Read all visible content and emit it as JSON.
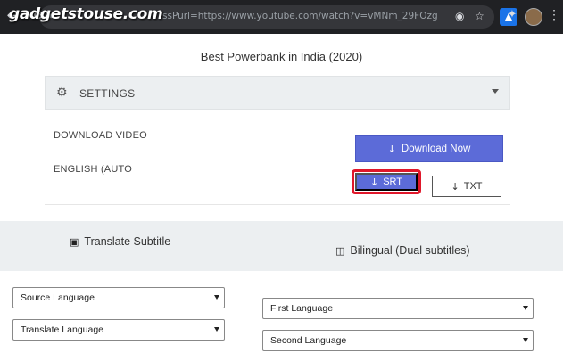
{
  "browser": {
    "back_icon": "←",
    "forward_icon": "→",
    "reload_icon": "⟳",
    "watermark": "gadgetstouse.com",
    "url": "ssPurl=https://www.youtube.com/watch?v=vMNm_29FOzg",
    "icons": [
      "back-icon",
      "forward-icon",
      "reload-icon",
      "lock-icon",
      "circle-icon",
      "star-icon",
      "extension-icon",
      "puzzle-icon",
      "avatar",
      "kebab-menu-icon"
    ]
  },
  "page": {
    "video_title": "Best Powerbank in India (2020)",
    "settings_label": "SETTINGS",
    "download_video_label": "DOWNLOAD VIDEO",
    "english_auto_label": "ENGLISH (AUTO",
    "download_now_label": "Download Now",
    "srt_label": "SRT",
    "txt_label": "TXT",
    "arrow": "↓"
  },
  "tabs": {
    "translate_label": "Translate Subtitle",
    "bilingual_label": "Bilingual (Dual subtitles)"
  },
  "selects": {
    "source_language": "Source Language",
    "translate_language": "Translate Language",
    "first_language": "First Language",
    "second_language": "Second Language"
  },
  "colors": {
    "accent": "#5c6bd8",
    "highlight": "#e0172a",
    "panel": "#eceff1",
    "browser": "#202124"
  }
}
